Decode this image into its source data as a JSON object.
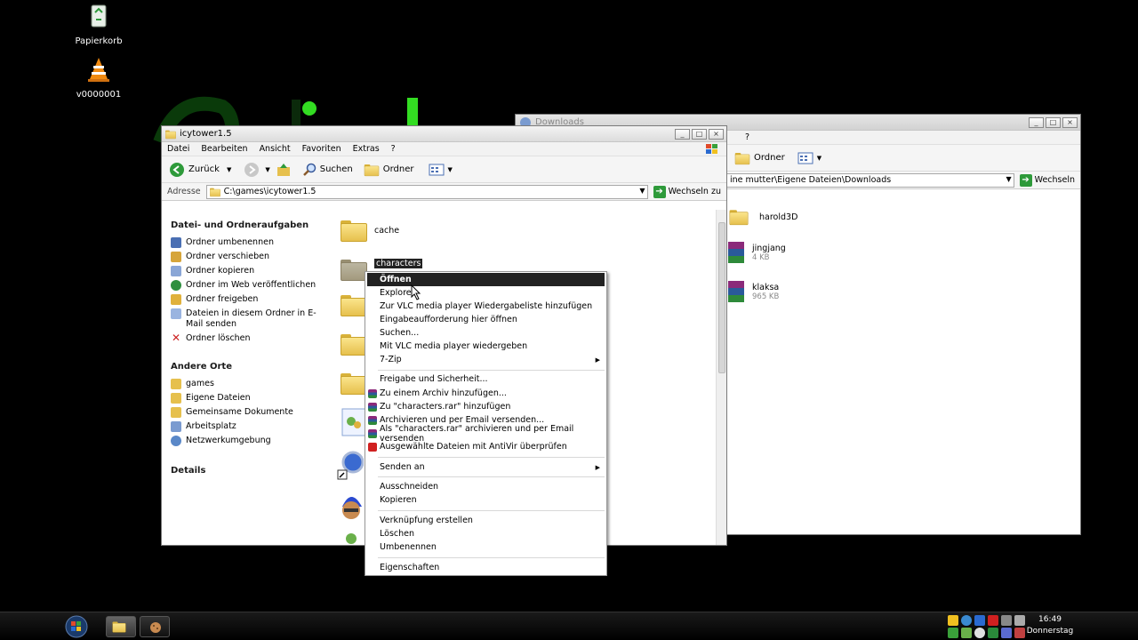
{
  "desktop": {
    "icons": [
      {
        "label": "Papierkorb",
        "icon": "recycle-bin-icon"
      },
      {
        "label": "v0000001",
        "icon": "vlc-cone-icon"
      }
    ]
  },
  "back_window": {
    "title": "Downloads",
    "menu_tail": "?",
    "toolbar": {
      "folders_label": "Ordner"
    },
    "address": {
      "value": "ine mutter\\Eigene Dateien\\Downloads",
      "go_label": "Wechseln"
    },
    "files": [
      {
        "name": "harold3D",
        "type": "folder",
        "size": ""
      },
      {
        "name": "jingjang",
        "type": "archive",
        "size": "4 KB"
      },
      {
        "name": "klaksa",
        "type": "archive",
        "size": "965 KB"
      }
    ]
  },
  "front_window": {
    "title": "icytower1.5",
    "menu": [
      "Datei",
      "Bearbeiten",
      "Ansicht",
      "Favoriten",
      "Extras",
      "?"
    ],
    "toolbar": {
      "back_label": "Zurück",
      "search_label": "Suchen",
      "folders_label": "Ordner"
    },
    "address": {
      "label": "Adresse",
      "value": "C:\\games\\icytower1.5",
      "go_label": "Wechseln zu"
    },
    "tasks": {
      "header": "Datei- und Ordneraufgaben",
      "items": [
        {
          "label": "Ordner umbenennen",
          "color": "#4a6fb3"
        },
        {
          "label": "Ordner verschieben",
          "color": "#d6a53a"
        },
        {
          "label": "Ordner kopieren",
          "color": "#8aa6d6"
        },
        {
          "label": "Ordner im Web veröffentlichen",
          "color": "#2f8f3f"
        },
        {
          "label": "Ordner freigeben",
          "color": "#e0b13c"
        },
        {
          "label": "Dateien in diesem Ordner in E-Mail senden",
          "color": "#9ab4e0"
        },
        {
          "label": "Ordner löschen",
          "color": "#cc2222"
        }
      ]
    },
    "places": {
      "header": "Andere Orte",
      "items": [
        {
          "label": "games",
          "color": "#e6c04d"
        },
        {
          "label": "Eigene Dateien",
          "color": "#e6c04d"
        },
        {
          "label": "Gemeinsame Dokumente",
          "color": "#e6c04d"
        },
        {
          "label": "Arbeitsplatz",
          "color": "#7a9bd0"
        },
        {
          "label": "Netzwerkumgebung",
          "color": "#5a88c8"
        }
      ]
    },
    "details_header": "Details",
    "files": [
      {
        "name": "cache"
      },
      {
        "name": "characters"
      }
    ]
  },
  "context_menu": {
    "items": [
      {
        "label": "Öffnen",
        "selected": true
      },
      {
        "label": "Explorer"
      },
      {
        "label": "Zur VLC media player Wiedergabeliste hinzufügen"
      },
      {
        "label": "Eingabeaufforderung hier öffnen"
      },
      {
        "label": "Suchen..."
      },
      {
        "label": "Mit VLC media player wiedergeben"
      },
      {
        "label": "7-Zip",
        "submenu": true
      },
      {
        "label": "Freigabe und Sicherheit..."
      },
      {
        "label": "Zu einem Archiv hinzufügen...",
        "icon": "winrar-icon"
      },
      {
        "label": "Zu \"characters.rar\" hinzufügen",
        "icon": "winrar-icon"
      },
      {
        "label": "Archivieren und per Email versenden...",
        "icon": "winrar-icon"
      },
      {
        "label": "Als \"characters.rar\" archivieren und per Email versenden",
        "icon": "winrar-icon"
      },
      {
        "label": "Ausgewählte Dateien mit AntiVir überprüfen",
        "icon": "antivir-icon"
      },
      {
        "label": "Senden an",
        "submenu": true
      },
      {
        "label": "Ausschneiden"
      },
      {
        "label": "Kopieren"
      },
      {
        "label": "Verknüpfung erstellen"
      },
      {
        "label": "Löschen"
      },
      {
        "label": "Umbenennen"
      },
      {
        "label": "Eigenschaften"
      }
    ]
  },
  "taskbar": {
    "clock_time": "16:49",
    "clock_day": "Donnerstag"
  },
  "colors": {
    "selection": "#222222",
    "go_green": "#2e9a3a",
    "folder": "#e6c04d"
  }
}
